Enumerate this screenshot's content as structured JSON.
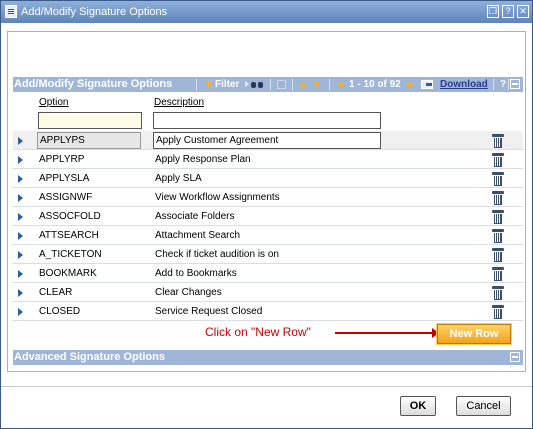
{
  "window": {
    "title": "Add/Modify Signature Options",
    "controls": [
      "restore",
      "help",
      "close"
    ]
  },
  "section_main": {
    "title": "Add/Modify Signature Options",
    "toolbar": {
      "filter_label": "Filter",
      "pagination": "1 - 10 of 92",
      "download_label": "Download",
      "help_label": "?"
    }
  },
  "table": {
    "columns": [
      "Option",
      "Description"
    ],
    "filters": {
      "option": "",
      "description": ""
    },
    "rows": [
      {
        "option": "APPLYPS",
        "description": "Apply Customer Agreement",
        "selected": true
      },
      {
        "option": "APPLYRP",
        "description": "Apply Response Plan"
      },
      {
        "option": "APPLYSLA",
        "description": "Apply SLA"
      },
      {
        "option": "ASSIGNWF",
        "description": "View Workflow Assignments"
      },
      {
        "option": "ASSOCFOLD",
        "description": "Associate Folders"
      },
      {
        "option": "ATTSEARCH",
        "description": "Attachment Search"
      },
      {
        "option": "A_TICKETON",
        "description": "Check if ticket audition is on"
      },
      {
        "option": "BOOKMARK",
        "description": "Add to Bookmarks"
      },
      {
        "option": "CLEAR",
        "description": "Clear Changes"
      },
      {
        "option": "CLOSED",
        "description": "Service Request Closed"
      }
    ]
  },
  "annotation": {
    "text": "Click on \"New Row\""
  },
  "new_row_label": "New Row",
  "section_advanced": {
    "title": "Advanced Signature Options"
  },
  "footer": {
    "ok_label": "OK",
    "cancel_label": "Cancel"
  },
  "colors": {
    "accent": "#9fb6d8",
    "titlebar": "#6f92c6",
    "new_row": "#f3a21c",
    "annotation": "#cc0000"
  }
}
